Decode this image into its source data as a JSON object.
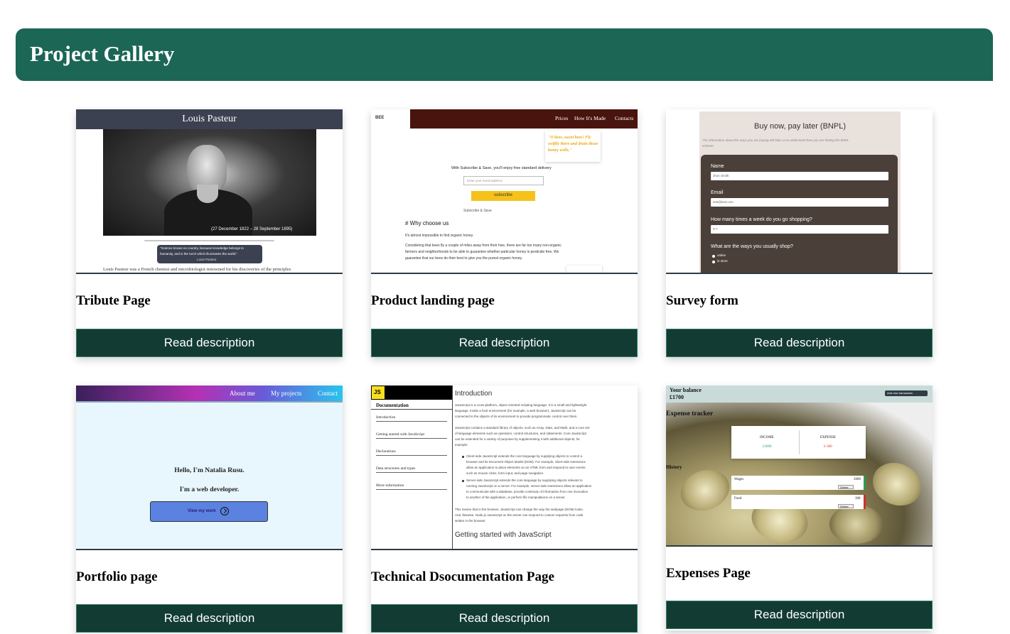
{
  "header": {
    "title": "Project Gallery"
  },
  "button_label": "Read description",
  "projects": [
    {
      "title": "Tribute Page",
      "preview": {
        "heading": "Louis Pasteur",
        "photo_caption": "(27 December 1822 – 28 September 1895)",
        "quote_line1": "\"Science knows no country, because knowledge belongs to",
        "quote_line2": "humanity, and is the torch which illuminates the world.\"",
        "quote_author": "Louis Pasteur",
        "body_line": "Louis Pasteur was a French chemist and microbiologist renowned for his discoveries of the principles"
      }
    },
    {
      "title": "Product landing page",
      "preview": {
        "logo": "BEE",
        "nav": [
          "Prices",
          "How It's Made",
          "Contacts"
        ],
        "quote": "\"O bees, sweet bees! Fly swiftly there and drain those honey wells.\"",
        "offer": "With Subscribe & Save, you'll enjoy free standard delivery",
        "email_placeholder": "Enter your email address",
        "subscribe": "subscribe",
        "subscribe_note": "Subscribe & Save",
        "section": "# Why choose us",
        "text1": "It's almost impossible to find organic honey.",
        "text2": "Considering that bees fly a couple of miles away from their hive, there are far too many non-organic",
        "text3": "farmers and neighborhoods to be able to guarantee whether particular honey is pesticide free. We",
        "text4": "guarantee that our bees do their best to give you the purest organic honey."
      }
    },
    {
      "title": "Survey form",
      "preview": {
        "heading": "Buy now, pay later (BNPL)",
        "intro1": "The information about the ways you are paying will help us to understand how you are finding the BNPL",
        "intro2": "scheme",
        "name_label": "Name",
        "name_value": "Jhon Smith",
        "email_label": "Email",
        "email_value": "test@test.com",
        "shopping_label": "How many times a week do you go shopping?",
        "shopping_value": "0-7",
        "ways_label": "What are the ways you usually shop?",
        "option1": "online",
        "option2": "in store"
      }
    },
    {
      "title": "Portfolio page",
      "preview": {
        "nav": [
          "About me",
          "My projects",
          "Contact"
        ],
        "greeting": "Hello, I'm Natalia Rusu.",
        "role": "I'm a web developer.",
        "cta": "View my work"
      }
    },
    {
      "title": "Technical Dsocumentation Page",
      "preview": {
        "logo": "JS",
        "nav_title": "Documentation",
        "nav_links": [
          "Introduction",
          "Getting started with JavaScript",
          "Declarations",
          "Data structures and types",
          "More information"
        ],
        "section1": "Introduction",
        "p1": [
          "JavaScript is a cross-platform, object-oriented scripting language. It is a small and lightweight",
          "language. Inside a host environment (for example, a web browser), JavaScript can be",
          "connected to the objects of its environment to provide programmatic control over them."
        ],
        "p2": [
          "JavaScript contains a standard library of objects, such as Array, Date, and Math, and a core set",
          "of language elements such as operators, control structures, and statements. Core JavaScript",
          "can be extended for a variety of purposes by supplementing it with additional objects; for",
          "example:"
        ],
        "b1": [
          "Client-side JavaScript extends the core language by supplying objects to control a",
          "browser and its Document Object Model (DOM). For example, client-side extensions",
          "allow an application to place elements on an HTML form and respond to user events",
          "such as mouse clicks, form input, and page navigation."
        ],
        "b2": [
          "Server-side JavaScript extends the core language by supplying objects relevant to",
          "running JavaScript on a server. For example, server-side extensions allow an application",
          "to communicate with a database, provide continuity of information from one invocation",
          "to another of the application, or perform file manipulations on a server."
        ],
        "p3": [
          "This means that in the browser, JavaScript can change the way the webpage (DOM) looks.",
          "And, likewise, Node.js JavaScript on the server can respond to custom requests from code",
          "written in the browser."
        ],
        "section2": "Getting started with JavaScript"
      }
    },
    {
      "title": "Expenses Page",
      "preview": {
        "balance_label": "Your balance",
        "balance_value": "£1700",
        "add_button": "Add new transaction",
        "tracker": "Expense tracker",
        "income_label": "INCOME",
        "income_value": "£3000",
        "expense_label": "EXPENSE",
        "expense_value": "£-300",
        "history": "History",
        "tx1_name": "Wages",
        "tx1_amount": "2000",
        "tx2_name": "Food",
        "tx2_amount": "300",
        "delete": "Delete"
      }
    }
  ],
  "colors": {
    "header_bg": "#1c6655",
    "button_bg": "#123b33",
    "button_border": "#2e7d67"
  }
}
